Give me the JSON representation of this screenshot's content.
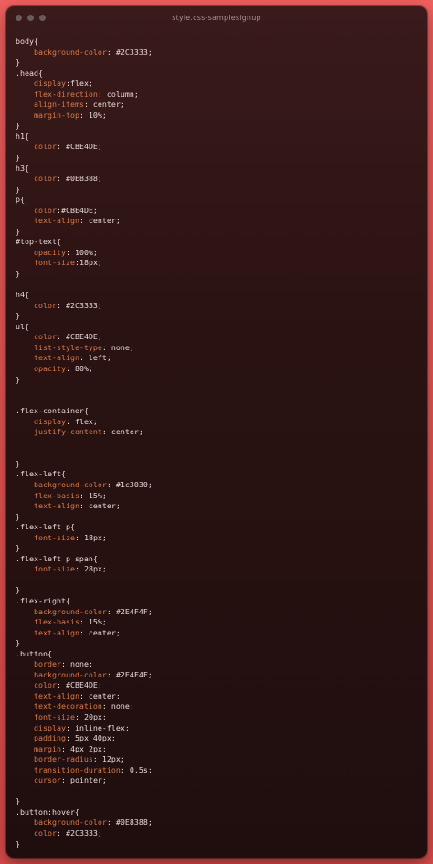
{
  "window": {
    "title": "style.css-samplesignup"
  },
  "code_lines": [
    "body{",
    "    background-color: #2C3333;",
    "}",
    ".head{",
    "    display:flex;",
    "    flex-direction: column;",
    "    align-items: center;",
    "    margin-top: 10%;",
    "}",
    "h1{",
    "    color: #CBE4DE;",
    "}",
    "h3{",
    "    color: #0E8388;",
    "}",
    "p{",
    "    color:#CBE4DE;",
    "    text-align: center;",
    "}",
    "#top-text{",
    "    opacity: 100%;",
    "    font-size:18px;",
    "}",
    "",
    "h4{",
    "    color: #2C3333;",
    "}",
    "ul{",
    "    color: #CBE4DE;",
    "    list-style-type: none;",
    "    text-align: left;",
    "    opacity: 80%;",
    "}",
    "",
    "",
    ".flex-container{",
    "    display: flex;",
    "    justify-content: center;",
    "",
    "",
    "}",
    ".flex-left{",
    "    background-color: #1c3030;",
    "    flex-basis: 15%;",
    "    text-align: center;",
    "}",
    ".flex-left p{",
    "    font-size: 18px;",
    "}",
    ".flex-left p span{",
    "    font-size: 28px;",
    "",
    "}",
    ".flex-right{",
    "    background-color: #2E4F4F;",
    "    flex-basis: 15%;",
    "    text-align: center;",
    "}",
    ".button{",
    "    border: none;",
    "    background-color: #2E4F4F;",
    "    color: #CBE4DE;",
    "    text-align: center;",
    "    text-decoration: none;",
    "    font-size: 20px;",
    "    display: inline-flex;",
    "    padding: 5px 40px;",
    "    margin: 4px 2px;",
    "    border-radius: 12px;",
    "    transition-duration: 0.5s;",
    "    cursor: pointer;",
    "",
    "}",
    ".button:hover{",
    "    background-color: #0E8388;",
    "    color: #2C3333;",
    "}"
  ]
}
